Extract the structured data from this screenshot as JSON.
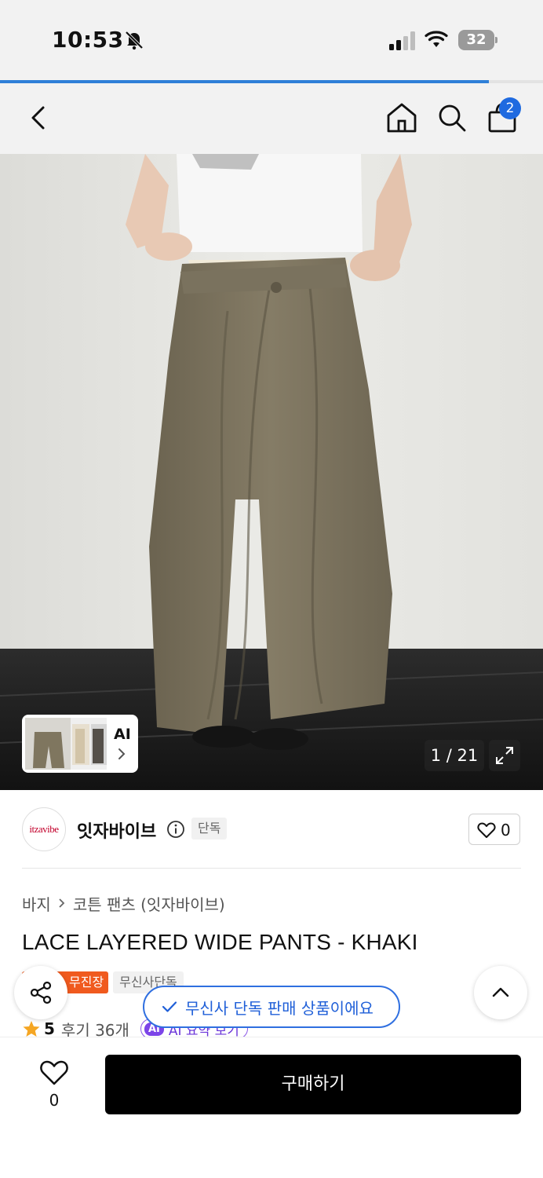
{
  "status_bar": {
    "time": "10:53",
    "battery": "32",
    "icons": [
      "bell-slash-icon",
      "signal-icon",
      "wifi-icon",
      "battery-icon"
    ]
  },
  "page_load_progress": 0.9,
  "nav": {
    "icons": [
      "back-icon",
      "home-icon",
      "search-icon",
      "shopping-bag-icon"
    ],
    "cart_count": "2"
  },
  "gallery": {
    "ai_label": "AI",
    "counter": "1 / 21",
    "icons": [
      "chevron-right-icon",
      "expand-icon"
    ]
  },
  "brand": {
    "logo_text": "itzavibe",
    "name": "잇자바이브",
    "exclusive_tag": "단독",
    "like_count": "0",
    "icons": [
      "info-icon",
      "heart-icon"
    ]
  },
  "breadcrumb": {
    "category": "바지",
    "subcategory": "코튼 팬츠 (잇자바이브)"
  },
  "product": {
    "title": "LACE LAYERED WIDE PANTS - KHAKI",
    "tags": [
      "무진장",
      "무신사단독"
    ],
    "rating": "5",
    "review_label": "후기 36개",
    "ai_badge": "AI",
    "ai_summary_label": "AI 요약 보기"
  },
  "toast": {
    "message": "무신사 단독 판매 상품이에요"
  },
  "bottom_bar": {
    "like_count": "0",
    "buy_label": "구매하기"
  },
  "colors": {
    "accent_blue": "#2f6fe0",
    "tag_orange": "#f05a1e",
    "ai_purple": "#7c44e8",
    "buy_button": "#000000"
  }
}
